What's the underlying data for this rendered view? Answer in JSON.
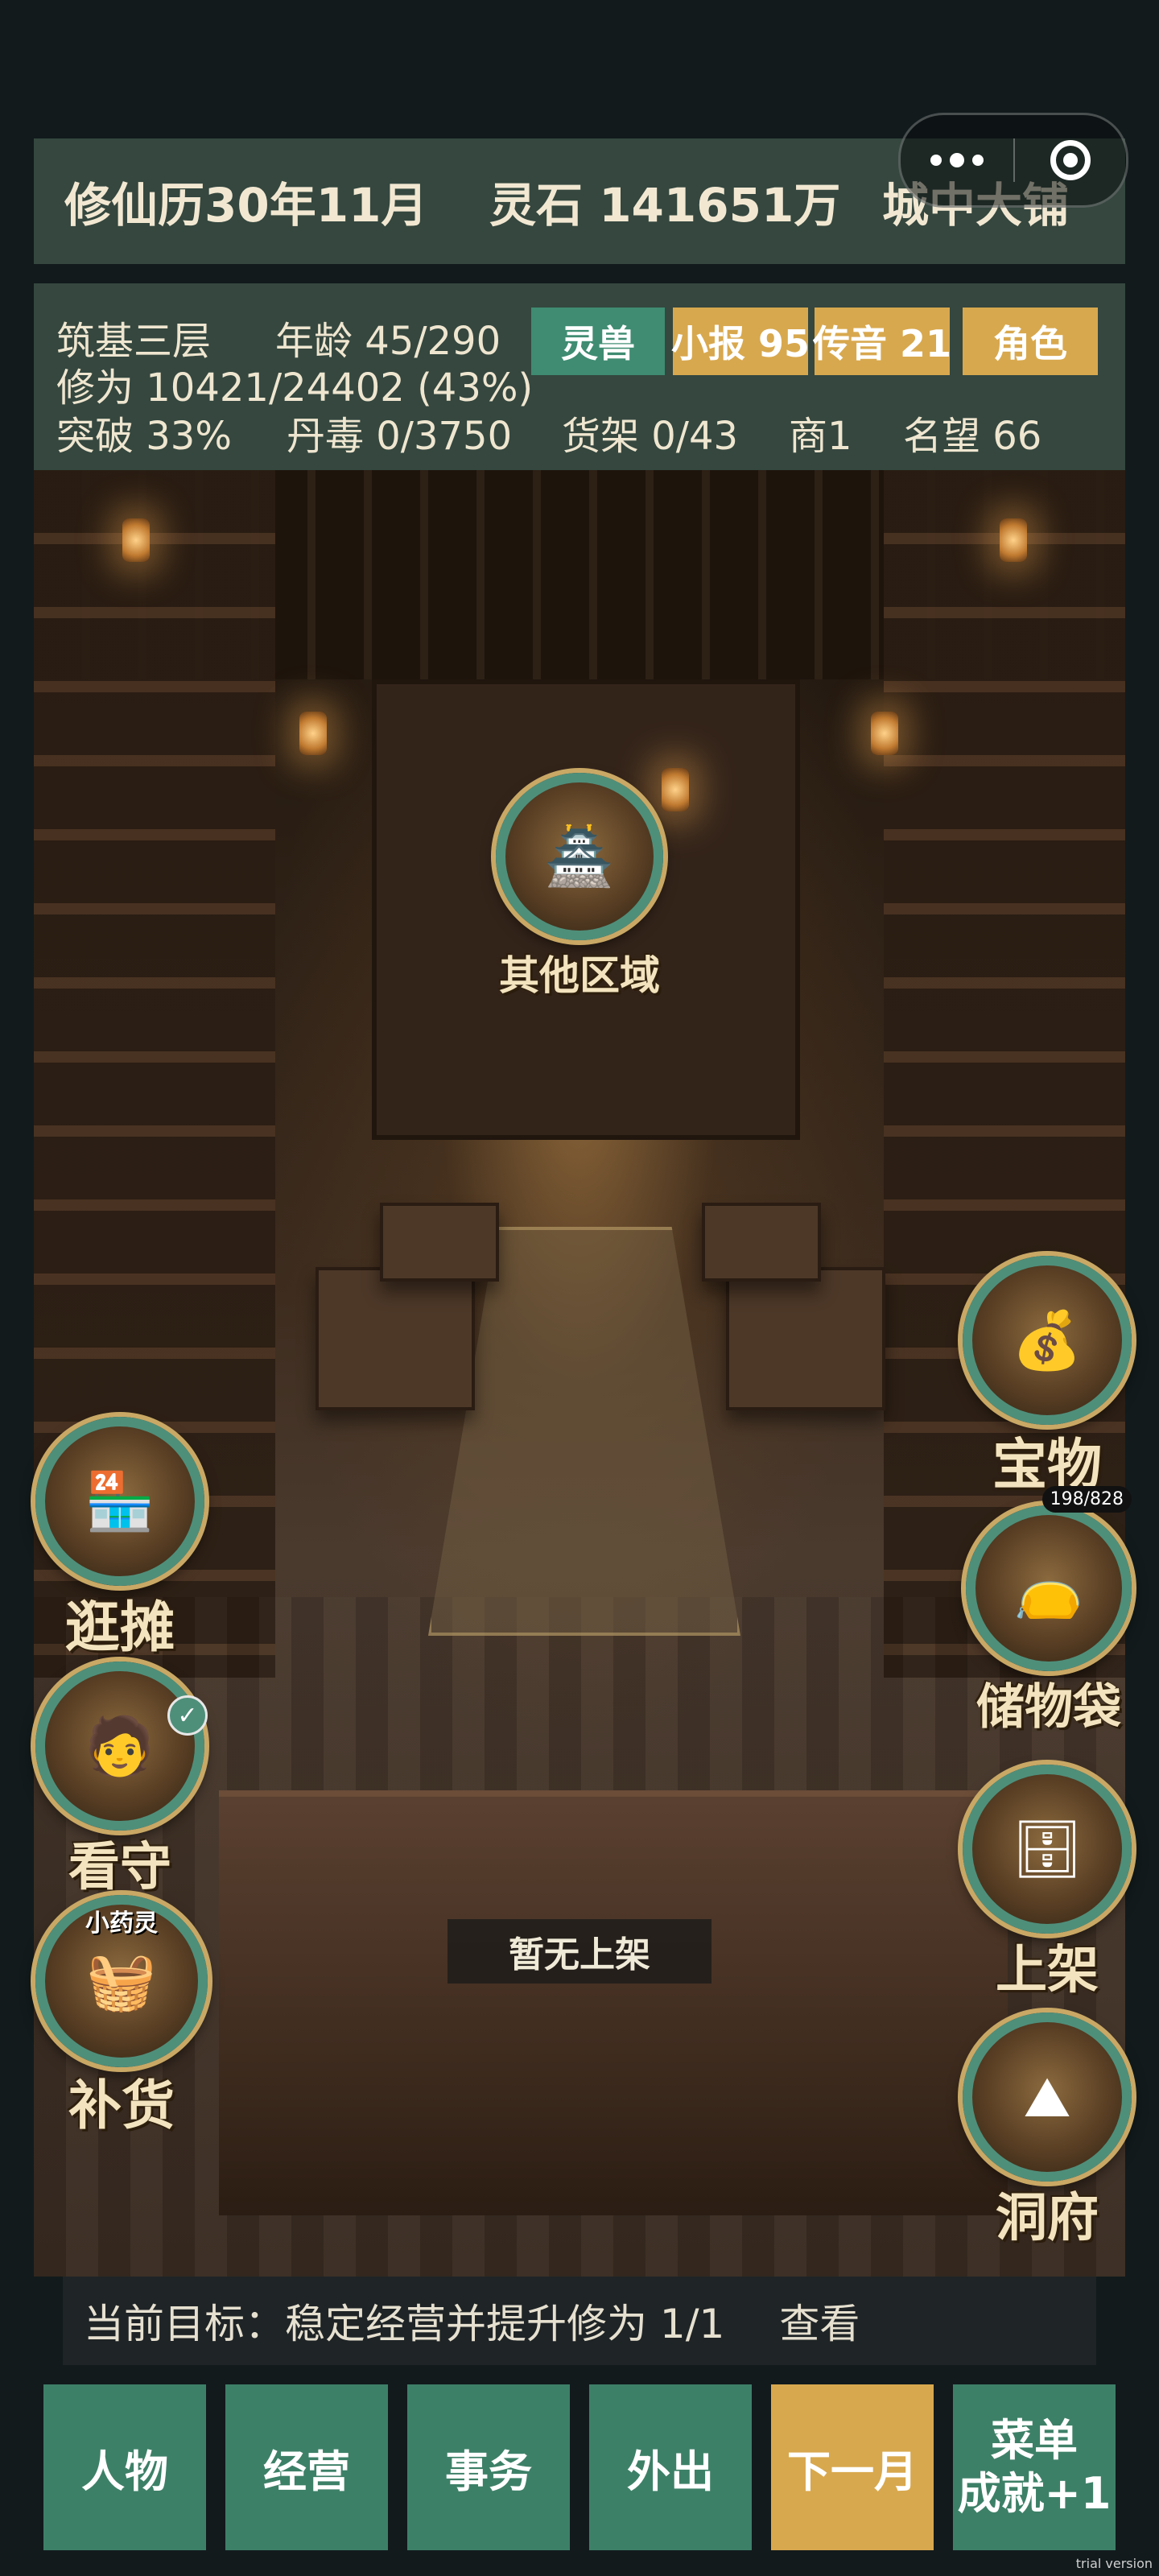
{
  "header": {
    "date": "修仙历30年11月",
    "spirit_stone": "灵石 141651万",
    "location": "城中大铺"
  },
  "stats": {
    "realm": "筑基三层",
    "age": "年龄 45/290",
    "cultivation": "修为 10421/24402 (43%)",
    "breakthrough": "突破 33%",
    "pill_poison": "丹毒 0/3750",
    "shelves": "货架 0/43",
    "merchant": "商1",
    "reputation": "名望 66"
  },
  "tags": {
    "spirit_beast": "灵兽",
    "news": "小报 95",
    "messages": "传音 21",
    "character": "角色"
  },
  "scene": {
    "other_areas": "其他区域",
    "treasures": "宝物",
    "storage_bag": "储物袋",
    "storage_count": "198/828",
    "stall": "逛摊",
    "guard": "看守",
    "restock": "补货",
    "restock_sub": "小药灵",
    "list_items": "上架",
    "cave": "洞府",
    "empty_shelf": "暂无上架"
  },
  "goal": {
    "text": "当前目标：稳定经营并提升修为 1/1",
    "view": "查看"
  },
  "nav": {
    "character": "人物",
    "business": "经营",
    "affairs": "事务",
    "go_out": "外出",
    "next_month": "下一月",
    "menu_line1": "菜单",
    "menu_line2": "成就+1"
  },
  "watermark": "trial version",
  "colors": {
    "panel": "#35473f",
    "accent_green": "#3d8068",
    "accent_gold": "#d8a84e",
    "background": "#121a1c"
  }
}
